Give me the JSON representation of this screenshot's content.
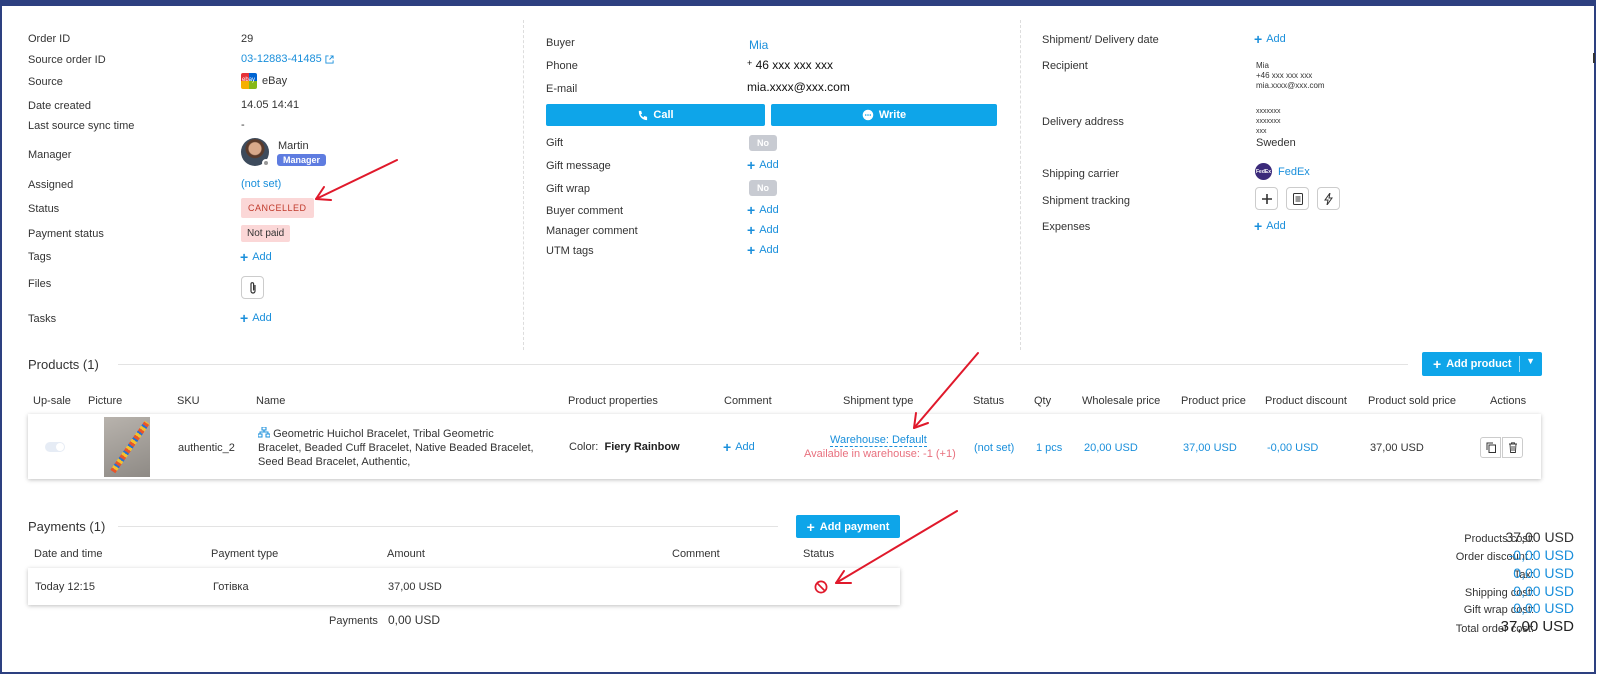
{
  "order": {
    "order_id_label": "Order ID",
    "order_id": "29",
    "source_order_id_label": "Source order ID",
    "source_order_id": "03-12883-41485",
    "source_label": "Source",
    "source_logo": "ebay",
    "source": "eBay",
    "date_created_label": "Date created",
    "date_created": "14.05 14:41",
    "last_sync_label": "Last source sync time",
    "last_sync": "-",
    "manager_label": "Manager",
    "manager_name": "Martin",
    "manager_badge": "Manager",
    "assigned_label": "Assigned",
    "assigned": "(not set)",
    "status_label": "Status",
    "status": "CANCELLED",
    "payment_status_label": "Payment status",
    "payment_status": "Not paid",
    "tags_label": "Tags",
    "files_label": "Files",
    "tasks_label": "Tasks",
    "add": "Add"
  },
  "buyer": {
    "buyer_label": "Buyer",
    "buyer": "Mia",
    "phone_label": "Phone",
    "phone_plus": "+",
    "phone": "46 xxx xxx xxx",
    "email_label": "E-mail",
    "email": "mia.xxxx@xxx.com",
    "call_label": "Call",
    "write_label": "Write",
    "gift_label": "Gift",
    "gift": "No",
    "gift_message_label": "Gift message",
    "gift_wrap_label": "Gift wrap",
    "gift_wrap": "No",
    "buyer_comment_label": "Buyer comment",
    "manager_comment_label": "Manager comment",
    "utm_label": "UTM tags"
  },
  "shipment": {
    "date_label": "Shipment/ Delivery date",
    "recipient_label": "Recipient",
    "recipient_name": "Mia",
    "recipient_phone": "+46 xxx xxx xxx",
    "recipient_email": "mia.xxxx@xxx.com",
    "address_label": "Delivery address",
    "addr1": "xxxxxxx",
    "addr2": "xxxxxxx",
    "addr3": "xxx",
    "country": "Sweden",
    "carrier_label": "Shipping carrier",
    "carrier_logo": "FedEx",
    "carrier": "FedEx",
    "tracking_label": "Shipment tracking",
    "expenses_label": "Expenses"
  },
  "products": {
    "title": "Products (1)",
    "add_product": "Add product",
    "columns": [
      "Up-sale",
      "Picture",
      "SKU",
      "Name",
      "Product properties",
      "Comment",
      "Shipment type",
      "Status",
      "Qty",
      "Wholesale price",
      "Product price",
      "Product discount",
      "Product sold price",
      "Actions"
    ],
    "row": {
      "sku": "authentic_2",
      "name": "Geometric Huichol Bracelet, Tribal Geometric Bracelet, Beaded Cuff Bracelet, Native Beaded Bracelet, Seed Bead Bracelet, Authentic,",
      "prop_label": "Color:",
      "prop_value": "Fiery Rainbow",
      "comment_add": "Add",
      "shipment_type": "Warehouse: Default",
      "available": "Available in warehouse: -1 (+1)",
      "status": "(not set)",
      "qty": "1 pcs",
      "wholesale": "20,00 USD",
      "price": "37,00 USD",
      "discount": "-0,00 USD",
      "sold": "37,00 USD"
    }
  },
  "payments": {
    "title": "Payments (1)",
    "add_payment": "Add payment",
    "columns": [
      "Date and time",
      "Payment type",
      "Amount",
      "Comment",
      "Status"
    ],
    "row": {
      "date": "Today 12:15",
      "type": "Готівка",
      "amount": "37,00 USD"
    },
    "total_label": "Payments",
    "total": "0,00 USD"
  },
  "summary": {
    "products_cost_label": "Products cost:",
    "products_cost": "37,00 USD",
    "order_discount_label": "Order discount :",
    "order_discount": "-0,00 USD",
    "tax_label": "Tax:",
    "tax": "0,00 USD",
    "shipping_label": "Shipping cost:",
    "shipping": "0,00 USD",
    "gift_wrap_label": "Gift wrap cost:",
    "gift_wrap": "0,00 USD",
    "total_label": "Total order cost:",
    "total": "37,00 USD"
  },
  "colors": {
    "accent": "#0ea5e9",
    "link": "#1a8fdb",
    "cancel": "#c0392b",
    "annotation": "#e0192b"
  }
}
